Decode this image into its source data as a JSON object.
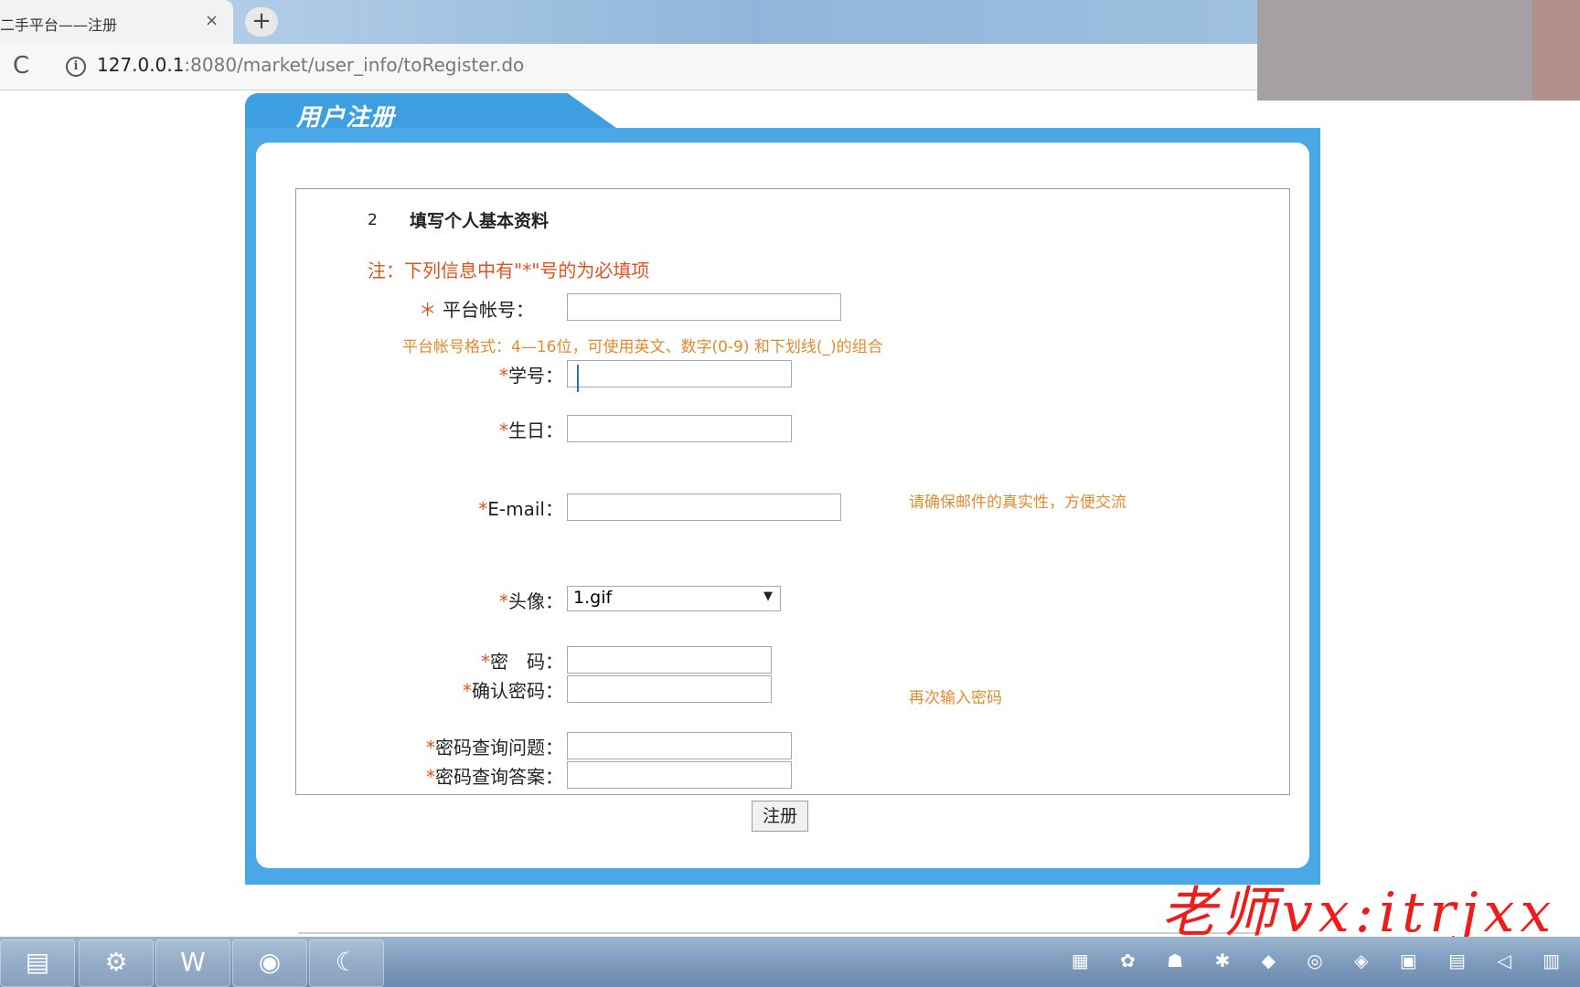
{
  "browser": {
    "tab_title": "二手平台——注册",
    "tab_close": "×",
    "new_tab": "+",
    "reload": "C",
    "info": "i",
    "url_host": "127.0.0.1",
    "url_rest": ":8080/market/user_info/toRegister.do"
  },
  "panel": {
    "title": "用户注册"
  },
  "form": {
    "step_number": "2",
    "step_title": "填写个人基本资料",
    "note": "注：下列信息中有\"*\"号的为必填项",
    "account_label": "平台帐号：",
    "account_star": "＊",
    "account_hint": "平台帐号格式：4—16位，可使用英文、数字(0-9) 和下划线(_)的组合",
    "student_id_label": "学号：",
    "birthday_label": "生日：",
    "email_label": "E-mail：",
    "email_hint": "请确保邮件的真实性，方便交流",
    "avatar_label": "头像：",
    "avatar_value": "1.gif",
    "avatar_arrow": "▼",
    "password_label": "密　码：",
    "confirm_password_label": "确认密码：",
    "confirm_hint": "再次输入密码",
    "question_label": "密码查询问题：",
    "answer_label": "密码查询答案：",
    "star": "*",
    "submit": "注册"
  },
  "watermark": "老师vx:itrjxx",
  "taskbar": {
    "apps": [
      "explorer-icon",
      "java-ee-ide-icon",
      "word-icon",
      "chrome-icon",
      "dolphin-icon"
    ],
    "tray": "▦ ✿ ☗ ✱ ◆ ◎ ◈ ▣ ▤ ◁ ▥"
  }
}
